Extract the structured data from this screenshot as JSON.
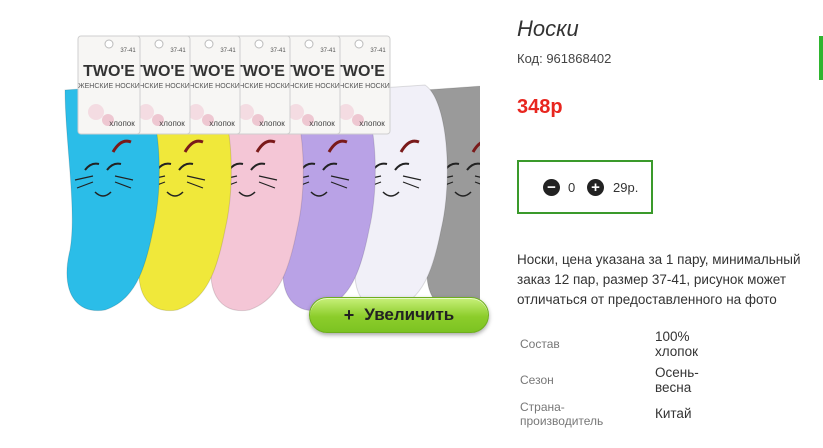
{
  "product": {
    "title": "Носки",
    "code": "Код: 961868402",
    "price": "348р",
    "description": "Носки, цена указана за 1 пару, минимальный заказ 12 пар, размер 37-41, рисунок может отличаться от предоставленного на фото"
  },
  "image": {
    "zoom_label": "Увеличить",
    "zoom_icon": "plus-icon",
    "package_brand": "TWO'E",
    "package_subtitle": "ЖЕНСКИЕ НОСКИ",
    "package_size": "37-41",
    "package_material": "хлопок",
    "sock_colors": [
      "#2bbde8",
      "#f0e83a",
      "#f4c6d6",
      "#b9a2e6",
      "#f1f0f8",
      "#9a9a9a"
    ]
  },
  "quantity": {
    "minus_icon": "minus-circle-icon",
    "plus_icon": "plus-circle-icon",
    "minus_symbol": "−",
    "plus_symbol": "+",
    "value": "0",
    "unit_price": "29р."
  },
  "specs": [
    {
      "label": "Состав",
      "value_line1": "100%",
      "value_line2": "хлопок"
    },
    {
      "label": "Сезон",
      "value_line1": "Осень-",
      "value_line2": "весна"
    },
    {
      "label_line1": "Страна-",
      "label_line2": "производитель",
      "value_line1": "Китай"
    }
  ],
  "colors": {
    "price": "#e8261f",
    "qty_border": "#3a9a2b",
    "zoom_button": "#8ccd2b"
  }
}
